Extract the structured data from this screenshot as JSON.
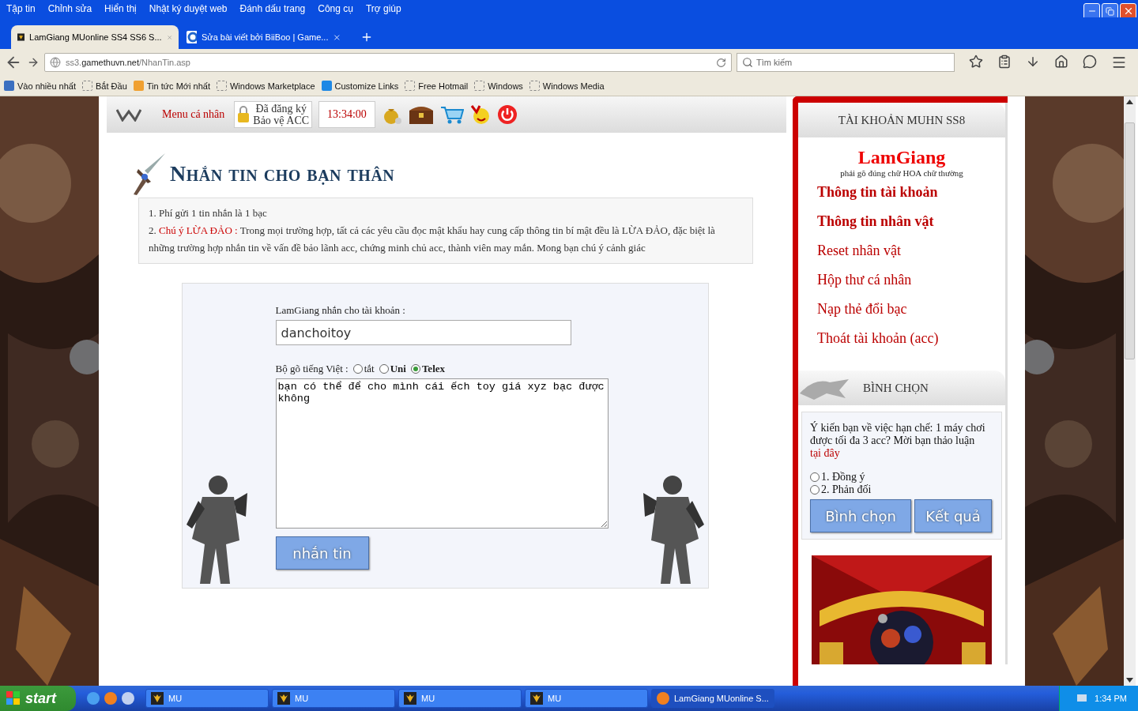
{
  "menu_bar": [
    "Tập tin",
    "Chỉnh sửa",
    "Hiển thị",
    "Nhật ký duyệt web",
    "Đánh dấu trang",
    "Công cụ",
    "Trợ giúp"
  ],
  "tabs": [
    {
      "title": "LamGiang MUonline SS4 SS6 S...",
      "selected": true
    },
    {
      "title": "Sửa bài viết bởi BiiBoo | Game...",
      "selected": false
    }
  ],
  "address": {
    "prefix": "ss3.",
    "domain": "gamethuvn.net",
    "path": "/NhanTin.asp"
  },
  "search": {
    "placeholder": "Tìm kiếm"
  },
  "bookmarks": [
    {
      "label": "Vào nhiều nhất",
      "kind": "search"
    },
    {
      "label": "Bắt Đầu",
      "kind": "page"
    },
    {
      "label": "Tin tức Mới nhất",
      "kind": "feed"
    },
    {
      "label": "Windows Marketplace",
      "kind": "page"
    },
    {
      "label": "Customize Links",
      "kind": "windows"
    },
    {
      "label": "Free Hotmail",
      "kind": "page"
    },
    {
      "label": "Windows",
      "kind": "page"
    },
    {
      "label": "Windows Media",
      "kind": "page"
    }
  ],
  "site_header": {
    "menu": "Menu cá nhân",
    "protect": [
      "Đã đăng ký",
      "Bảo vệ ACC"
    ],
    "time": "13:34:00"
  },
  "title": "Nhắn tin cho bạn thân",
  "notices": [
    "1. Phí gửi 1 tin nhắn là 1 bạc",
    "2. *Chú ý LỪA ĐẢO :* Trong mọi trường hợp, tất cả các yêu cầu đọc mật khẩu hay cung cấp thông tin bí mật đều là LỪA ĐẢO, đặc biệt là những trường hợp nhắn tin về vấn đề bảo lãnh acc, chứng minh chủ acc, thành viên may mắn. Mong bạn chú ý cảnh giác"
  ],
  "form": {
    "recipient_label": "LamGiang nhắn cho tài khoản :",
    "recipient": "danchoitoy",
    "typing_label": "Bộ gõ tiếng Việt :",
    "typing_modes": [
      {
        "label": "tắt",
        "bold": false,
        "selected": false
      },
      {
        "label": "Uni",
        "bold": true,
        "selected": false
      },
      {
        "label": "Telex",
        "bold": true,
        "selected": true
      }
    ],
    "message": "bạn có thể để cho mình cái ếch toy giá xyz bạc được không",
    "send": "nhắn tin"
  },
  "account": {
    "heading": "TÀI KHOẢN MUHN SS8",
    "user": "LamGiang",
    "hint": "phải gõ đúng chữ HOA chữ thường",
    "links": [
      {
        "label": "Thông tin tài khoản",
        "bold": true
      },
      {
        "label": "Thông tin nhân vật",
        "bold": true
      },
      {
        "label": "Reset nhân vật",
        "bold": false
      },
      {
        "label": "Hộp thư cá nhân",
        "bold": false
      },
      {
        "label": "Nạp thẻ đổi bạc",
        "bold": false
      },
      {
        "label": "Thoát tài khoản (acc)",
        "bold": false
      }
    ]
  },
  "poll": {
    "heading": "BÌNH CHỌN",
    "question": "Ý kiến bạn về việc hạn chế: 1 máy chơi được tối đa 3 acc? Mời bạn thảo luận",
    "link": "tại đây",
    "options": [
      {
        "label": "1. Đồng ý",
        "selected": false
      },
      {
        "label": "2. Phản đối",
        "selected": false
      }
    ],
    "buttons": [
      "Bình chọn",
      "Kết quả"
    ]
  },
  "taskbar": {
    "start": "start",
    "windows": [
      {
        "label": "MU",
        "kind": "game",
        "selected": false
      },
      {
        "label": "MU",
        "kind": "game",
        "selected": false
      },
      {
        "label": "MU",
        "kind": "game",
        "selected": false
      },
      {
        "label": "MU",
        "kind": "game",
        "selected": false
      },
      {
        "label": "LamGiang MUonline S...",
        "kind": "browser",
        "selected": true
      }
    ],
    "clock": "1:34 PM"
  }
}
